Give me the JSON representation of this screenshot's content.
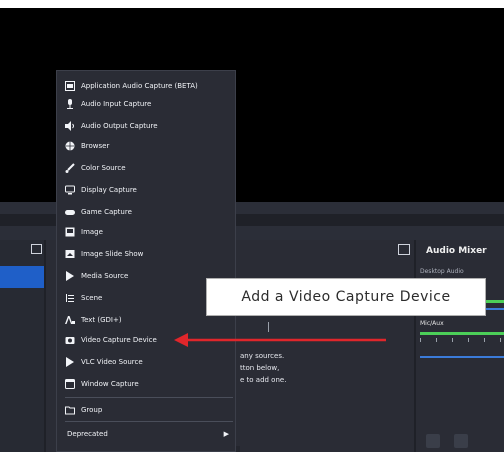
{
  "menu": {
    "items": [
      {
        "label": "Application Audio Capture (BETA)",
        "icon": "application-audio-icon"
      },
      {
        "label": "Audio Input Capture",
        "icon": "microphone-icon"
      },
      {
        "label": "Audio Output Capture",
        "icon": "speaker-icon"
      },
      {
        "label": "Browser",
        "icon": "globe-icon"
      },
      {
        "label": "Color Source",
        "icon": "paintbrush-icon"
      },
      {
        "label": "Display Capture",
        "icon": "monitor-icon"
      },
      {
        "label": "Game Capture",
        "icon": "gamepad-icon"
      },
      {
        "label": "Image",
        "icon": "image-icon"
      },
      {
        "label": "Image Slide Show",
        "icon": "slideshow-icon"
      },
      {
        "label": "Media Source",
        "icon": "play-icon"
      },
      {
        "label": "Scene",
        "icon": "scene-list-icon"
      },
      {
        "label": "Text (GDI+)",
        "icon": "text-icon"
      },
      {
        "label": "Video Capture Device",
        "icon": "camera-icon"
      },
      {
        "label": "VLC Video Source",
        "icon": "play-icon"
      },
      {
        "label": "Window Capture",
        "icon": "window-icon"
      }
    ],
    "group": {
      "label": "Group",
      "icon": "folder-icon"
    },
    "deprecated": {
      "label": "Deprecated",
      "arrow": "▶"
    }
  },
  "callout": {
    "text": "Add a Video Capture Device"
  },
  "sources": {
    "empty_text": "any sources.\ntton below,\ne to add one."
  },
  "mixer": {
    "title": "Audio Mixer",
    "subtitle": "Desktop Audio",
    "mic_label": "Mic/Aux"
  },
  "colors": {
    "accent": "#1f5fc8",
    "arrow": "#e0262b",
    "meter_green": "#4ccf58"
  }
}
